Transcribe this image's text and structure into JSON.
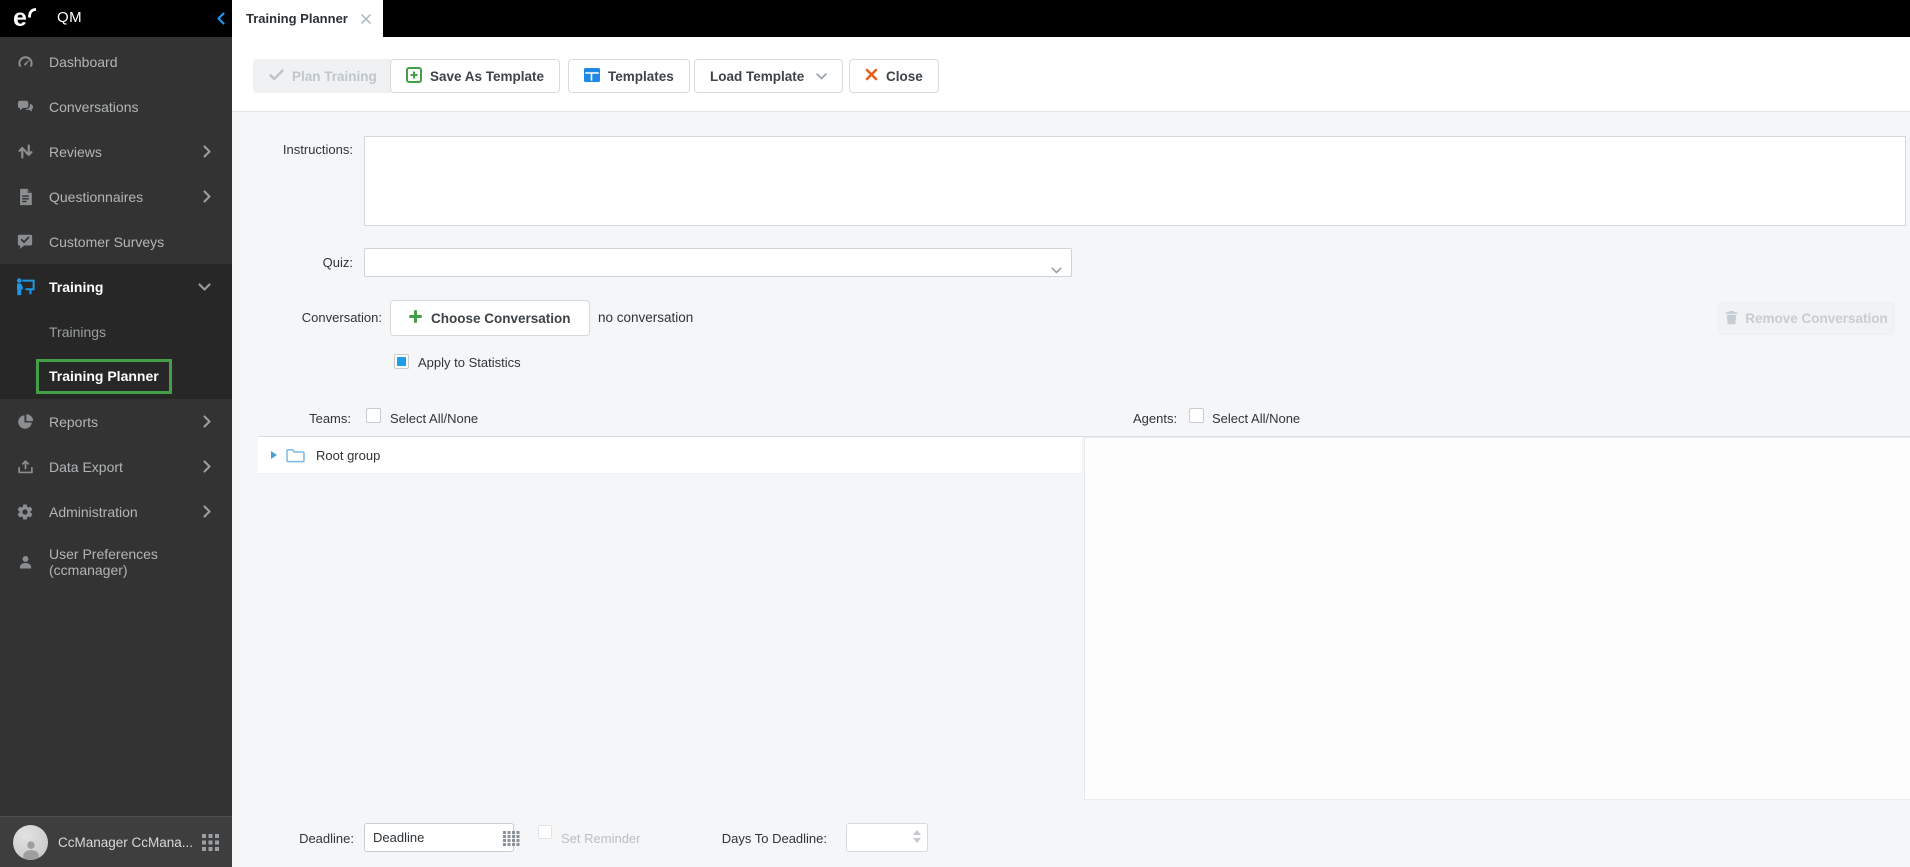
{
  "app": {
    "name": "QM",
    "logo": "eleveo-logo"
  },
  "topbar": {
    "tab": {
      "label": "Training Planner"
    }
  },
  "sidebar": {
    "items": [
      {
        "label": "Dashboard",
        "icon": "gauge"
      },
      {
        "label": "Conversations",
        "icon": "chat-bubbles"
      },
      {
        "label": "Reviews",
        "icon": "arrows-up-down",
        "has_submenu": true
      },
      {
        "label": "Questionnaires",
        "icon": "document",
        "has_submenu": true
      },
      {
        "label": "Customer Surveys",
        "icon": "survey-bubble"
      },
      {
        "label": "Training",
        "icon": "presenter",
        "active": true,
        "expanded": true
      },
      {
        "label": "Trainings",
        "submenu_of": "Training"
      },
      {
        "label": "Training Planner",
        "submenu_of": "Training",
        "selected": true
      },
      {
        "label": "Reports",
        "icon": "pie-chart",
        "has_submenu": true
      },
      {
        "label": "Data Export",
        "icon": "export-tray",
        "has_submenu": true
      },
      {
        "label": "Administration",
        "icon": "gear",
        "has_submenu": true
      },
      {
        "label": "User Preferences (ccmanager)",
        "icon": "person"
      }
    ],
    "user_bar": {
      "name": "CcManager CcMana..."
    }
  },
  "toolbar": {
    "plan_training": {
      "label": "Plan Training",
      "enabled": false
    },
    "save_as_template": {
      "label": "Save As Template",
      "enabled": true
    },
    "templates": {
      "label": "Templates",
      "enabled": true
    },
    "load_template": {
      "label": "Load Template",
      "enabled": true
    },
    "close": {
      "label": "Close",
      "enabled": true
    }
  },
  "form": {
    "instructions": {
      "label": "Instructions:",
      "value": ""
    },
    "quiz": {
      "label": "Quiz:",
      "value": ""
    },
    "conversation": {
      "label": "Conversation:",
      "choose_button": "Choose Conversation",
      "status": "no conversation",
      "remove_button": "Remove Conversation",
      "remove_enabled": false,
      "apply_to_statistics": {
        "label": "Apply to Statistics",
        "checked": true
      }
    },
    "teams": {
      "label": "Teams:",
      "select_all": "Select All/None",
      "checked": false,
      "tree": [
        {
          "label": "Root group",
          "type": "group",
          "expanded": false
        }
      ]
    },
    "agents": {
      "label": "Agents:",
      "select_all": "Select All/None",
      "checked": false,
      "list": []
    },
    "deadline": {
      "label": "Deadline:",
      "placeholder": "Deadline"
    },
    "set_reminder": {
      "label": "Set Reminder",
      "checked": false,
      "enabled": false
    },
    "days_to_deadline": {
      "label": "Days To Deadline:",
      "value": ""
    }
  },
  "colors": {
    "accent_blue": "#1e97e4",
    "green": "#43a047",
    "close_orange": "#e8611a",
    "selected_outline": "#43a047",
    "sidebar_bg": "#333333",
    "topbar_bg": "#000000"
  }
}
